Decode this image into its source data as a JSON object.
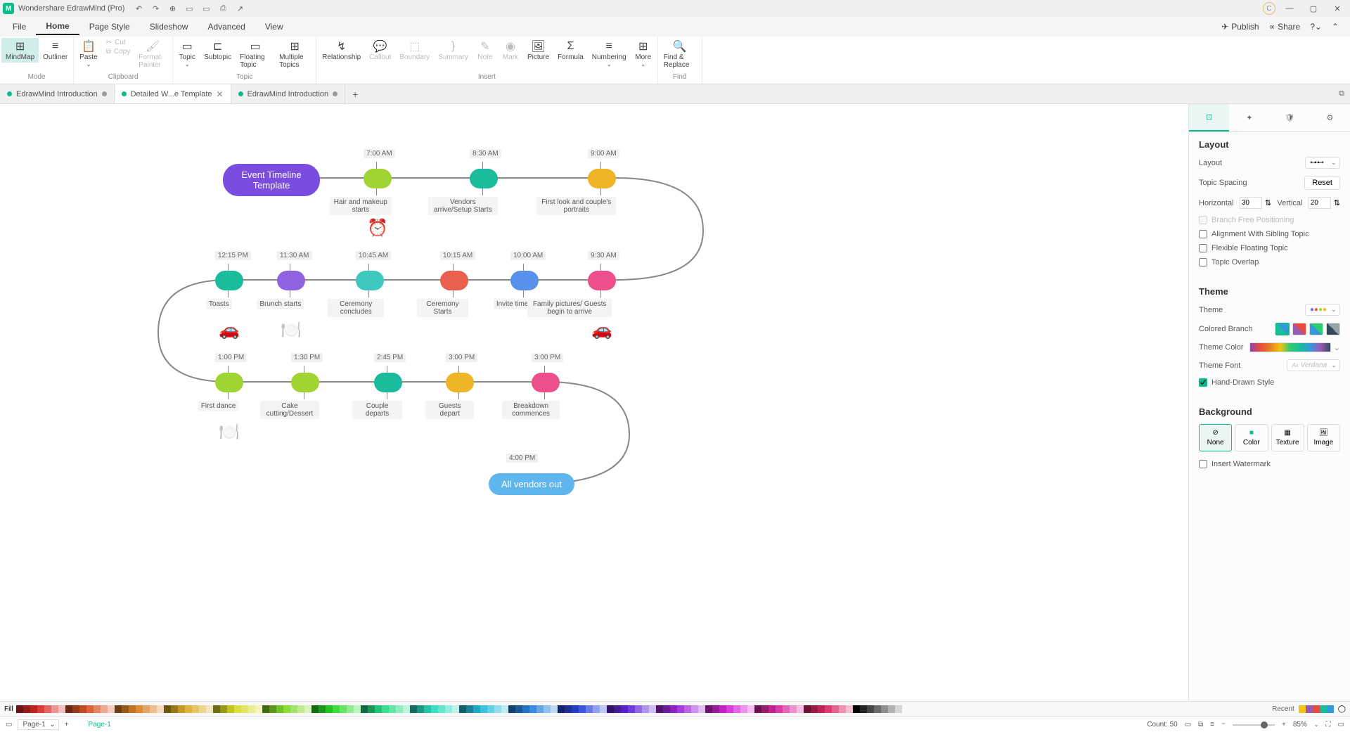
{
  "titlebar": {
    "app_name": "Wondershare EdrawMind (Pro)"
  },
  "menu": {
    "items": [
      "File",
      "Home",
      "Page Style",
      "Slideshow",
      "Advanced",
      "View"
    ],
    "active": 1,
    "right": {
      "publish": "Publish",
      "share": "Share"
    }
  },
  "ribbon": {
    "mode_label": "Mode",
    "mode": [
      {
        "l": "MindMap",
        "i": "⊞",
        "active": true
      },
      {
        "l": "Outliner",
        "i": "≡"
      }
    ],
    "clipboard_label": "Clipboard",
    "paste": "Paste",
    "cut": "Cut",
    "copy": "Copy",
    "format_painter": "Format Painter",
    "topic_label": "Topic",
    "topic": "Topic",
    "subtopic": "Subtopic",
    "floating": "Floating Topic",
    "multiple": "Multiple Topics",
    "insert_label": "Insert",
    "relationship": "Relationship",
    "callout": "Callout",
    "boundary": "Boundary",
    "summary": "Summary",
    "note": "Note",
    "mark": "Mark",
    "picture": "Picture",
    "formula": "Formula",
    "numbering": "Numbering",
    "more": "More",
    "find_label": "Find",
    "find_replace": "Find & Replace"
  },
  "tabs": [
    {
      "label": "EdrawMind Introduction",
      "unsaved": true
    },
    {
      "label": "Detailed W...e Template",
      "active": true,
      "closable": true
    },
    {
      "label": "EdrawMind Introduction",
      "unsaved": true
    }
  ],
  "timeline": {
    "root": "Event Timeline Template",
    "row1": [
      {
        "time": "7:00 AM",
        "label": "Hair and makeup starts",
        "color": "#a0d432",
        "emoji": "⏰"
      },
      {
        "time": "8:30 AM",
        "label": "Vendors arrive/Setup Starts",
        "color": "#1abc9c"
      },
      {
        "time": "9:00 AM",
        "label": "First look and couple's portraits",
        "color": "#f0b429"
      }
    ],
    "row2": [
      {
        "time": "12:15 PM",
        "label": "Toasts",
        "color": "#1abc9c",
        "emoji": "🚗"
      },
      {
        "time": "11:30 AM",
        "label": "Brunch starts",
        "color": "#8e62e0",
        "emoji": "🍽️"
      },
      {
        "time": "10:45 AM",
        "label": "Ceremony concludes",
        "color": "#3ec9c0"
      },
      {
        "time": "10:15 AM",
        "label": "Ceremony Starts",
        "color": "#e9604f"
      },
      {
        "time": "10:00 AM",
        "label": "Invite time",
        "color": "#5891ec"
      },
      {
        "time": "9:30 AM",
        "label": "Family pictures/ Guests begin to arrive",
        "color": "#ed4f8c",
        "emoji": "🚗"
      }
    ],
    "row3": [
      {
        "time": "1:00 PM",
        "label": "First dance",
        "color": "#a0d432",
        "emoji": "🍽️"
      },
      {
        "time": "1:30 PM",
        "label": "Cake cutting/Dessert",
        "color": "#a0d432"
      },
      {
        "time": "2:45 PM",
        "label": "Couple departs",
        "color": "#1abc9c"
      },
      {
        "time": "3:00 PM",
        "label": "Guests depart",
        "color": "#f0b429"
      },
      {
        "time": "3:00 PM",
        "label": "Breakdown commences",
        "color": "#ed4f8c"
      }
    ],
    "final": {
      "time": "4:00 PM",
      "label": "All vendors out",
      "color": "#5fb5ed"
    }
  },
  "right_panel": {
    "layout_h": "Layout",
    "layout_l": "Layout",
    "spacing_l": "Topic Spacing",
    "reset": "Reset",
    "horizontal_l": "Horizontal",
    "horizontal_v": "30",
    "vertical_l": "Vertical",
    "vertical_v": "20",
    "branch_free": "Branch Free Positioning",
    "align_sibling": "Alignment With Sibling Topic",
    "flex_float": "Flexible Floating Topic",
    "topic_overlap": "Topic Overlap",
    "theme_h": "Theme",
    "theme_l": "Theme",
    "colored_branch": "Colored Branch",
    "theme_color": "Theme Color",
    "theme_font": "Theme Font",
    "theme_font_v": "Verdana",
    "hand_drawn": "Hand-Drawn Style",
    "background_h": "Background",
    "bg_none": "None",
    "bg_color": "Color",
    "bg_texture": "Texture",
    "bg_image": "Image",
    "watermark": "Insert Watermark"
  },
  "colorbar": {
    "fill": "Fill",
    "recent": "Recent"
  },
  "statusbar": {
    "page": "Page-1",
    "page_label": "Page-1",
    "count": "Count: 50",
    "zoom": "85%"
  }
}
